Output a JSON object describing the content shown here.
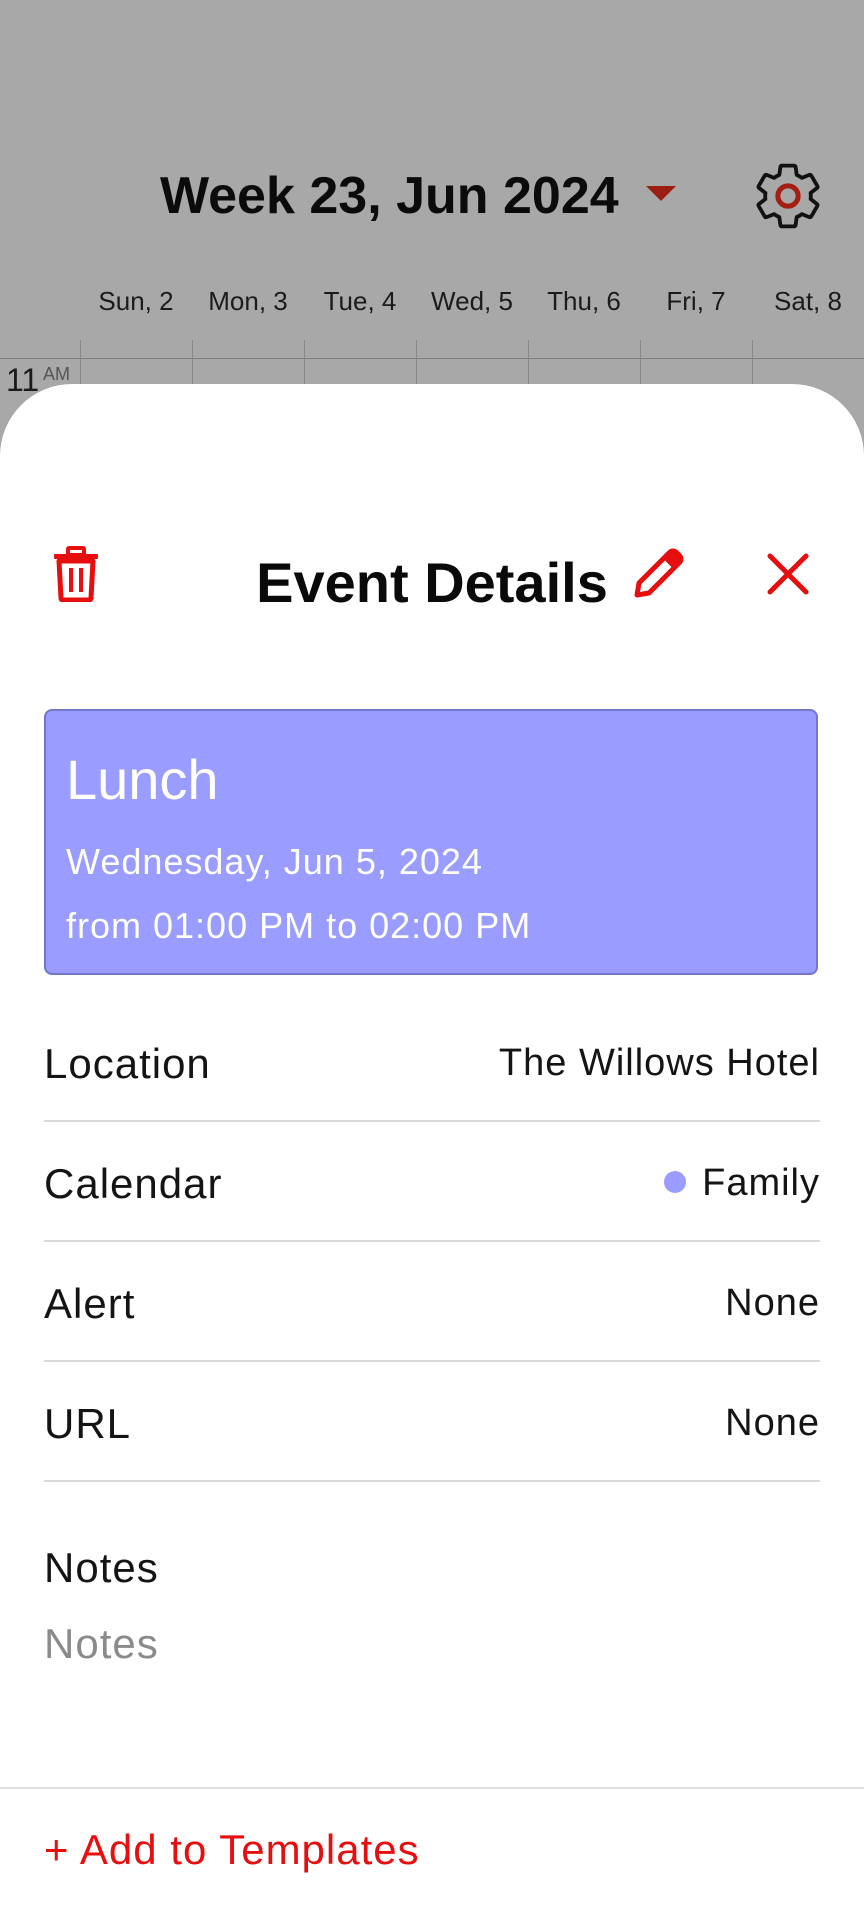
{
  "header": {
    "week_title": "Week 23, Jun 2024",
    "caret_icon": "caret-down-icon",
    "settings_icon": "gear-icon"
  },
  "days": [
    "Sun, 2",
    "Mon, 3",
    "Tue, 4",
    "Wed, 5",
    "Thu, 6",
    "Fri, 7",
    "Sat, 8"
  ],
  "grid": {
    "hour": "11",
    "suffix": "AM"
  },
  "sheet": {
    "title": "Event Details",
    "delete_icon": "trash-icon",
    "edit_icon": "pencil-icon",
    "close_icon": "close-icon",
    "event": {
      "title": "Lunch",
      "date": "Wednesday, Jun 5, 2024",
      "time": "from 01:00 PM to 02:00 PM",
      "color": "#9a9cff"
    },
    "rows": [
      {
        "label": "Location",
        "value": "The Willows Hotel"
      },
      {
        "label": "Calendar",
        "value": "Family"
      },
      {
        "label": "Alert",
        "value": "None"
      },
      {
        "label": "URL",
        "value": "None"
      }
    ],
    "notes": {
      "label": "Notes",
      "placeholder": "Notes",
      "value": ""
    },
    "add_to_templates": "+ Add to Templates"
  },
  "colors": {
    "accent": "#e60e0e",
    "overlay": "#a8a8a8",
    "event": "#9a9cff"
  }
}
